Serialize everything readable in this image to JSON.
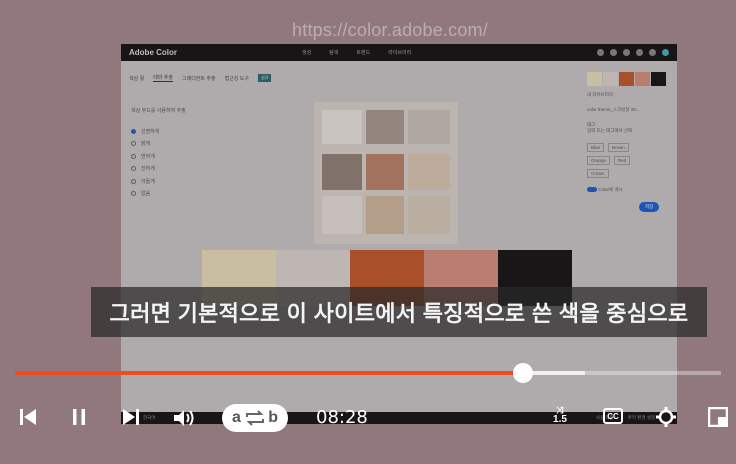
{
  "browser": {
    "url_overlay": "https://color.adobe.com/"
  },
  "site": {
    "brand": "Adobe Color",
    "menu": [
      "생성",
      "탐색",
      "트렌드",
      "라이브러리"
    ],
    "tabs": [
      "색상 휠",
      "테마 추출",
      "그래디언트 추출",
      "접근성 도구"
    ],
    "tab_badge": "신규",
    "options_heading": "색상 무드를 사용하여 추출",
    "options": [
      "선명하게",
      "밝게",
      "연하게",
      "진하게",
      "어둡게",
      "없음"
    ],
    "palette_colors": [
      "#e8dfb8",
      "#d9d5cf",
      "#c1582a",
      "#d6917e",
      "#121212"
    ],
    "panel_swatches": [
      "#e8dfb8",
      "#d9d5cf",
      "#c1582a",
      "#d6917e",
      "#121212"
    ],
    "panel_library_label": "내 라이브러리",
    "panel_name_value": "color theme_스크린샷 20...",
    "panel_tags_label": "태그",
    "panel_tags_placeholder": "입력 또는 태그에서 선택",
    "panel_chips": [
      "Blue",
      "Brown",
      "Orange",
      "Red",
      "Cream"
    ],
    "panel_toggle_label": "Color에 게시",
    "panel_save": "저장",
    "footer_items": [
      "한국어",
      "사용 약관",
      "쿠키 환경 설정"
    ]
  },
  "player": {
    "caption": "그러면 기본적으로 이 사이트에서 특징적으로 쓴 색을 중심으로",
    "played_fraction": 0.72,
    "buffered_fraction": 0.807,
    "ab_left": "a",
    "ab_right": "b",
    "time": "08:28",
    "speed": "1.5",
    "cc_label": "CC",
    "accent_color": "#ec4c1f"
  }
}
